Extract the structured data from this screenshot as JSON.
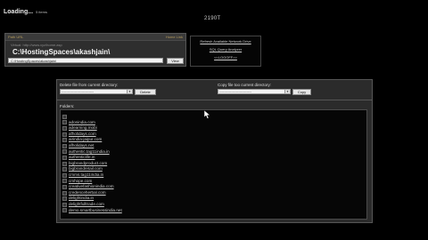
{
  "loading": {
    "title": "Loading...",
    "sub": "5 items"
  },
  "counter": "2190T",
  "path_panel": {
    "head_left": "Path URL",
    "head_right": "Home Link",
    "virtual_label": "Virtual: http://www.xyz/home.asp",
    "big_path": "C:\\HostingSpaces\\akashjain\\",
    "input_value": "C:\\HostingSpaces\\akashjain\\",
    "view_label": "View"
  },
  "links": [
    "Refresh Available Network Drive",
    "SQL Query Analyzer",
    "<<LOGOFF>>"
  ],
  "delete": {
    "label": "Delete file from current directory:",
    "select_value": "---------------------------",
    "button": "Delete"
  },
  "copy": {
    "label": "Copy file too current directory:",
    "select_value": "---------------------------",
    "button": "Copy"
  },
  "folders_label": "Folders:",
  "folders": [
    "",
    "adonindia.com",
    "adearning.mobi",
    "afholidays.com",
    "airindia-jaipur.com",
    "afholidays.net",
    "authentic.tag11india.in",
    "authenticlife.in",
    "bigbrandproduct.com",
    "bigbrandretail.com",
    "cmms.tag11india.in",
    "cmhope.com",
    "creativefashionindia.com",
    "credenceherbal.com",
    "delightindia.in",
    "delightfulltrade.com",
    "demo.smartbusinessindia.net"
  ]
}
